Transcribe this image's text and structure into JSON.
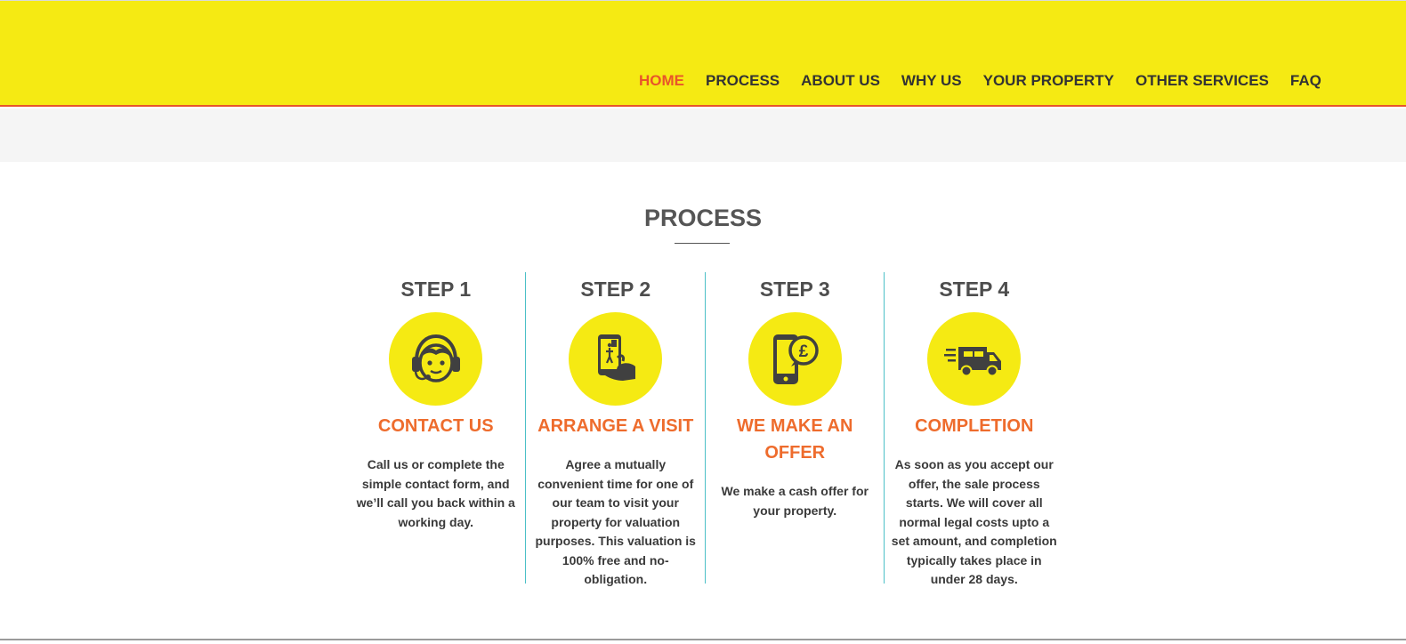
{
  "colors": {
    "header_bg": "#f5ea13",
    "accent": "#e8552a",
    "step_title": "#ee6c2d",
    "divider": "#4cc0c7",
    "icon": "#404040"
  },
  "nav": {
    "items": [
      {
        "label": "HOME",
        "active": true
      },
      {
        "label": "PROCESS",
        "active": false
      },
      {
        "label": "ABOUT US",
        "active": false
      },
      {
        "label": "WHY US",
        "active": false
      },
      {
        "label": "YOUR PROPERTY",
        "active": false
      },
      {
        "label": "OTHER SERVICES",
        "active": false
      },
      {
        "label": "FAQ",
        "active": false
      }
    ]
  },
  "section": {
    "title": "PROCESS"
  },
  "steps": [
    {
      "label": "STEP 1",
      "icon": "headset-person-icon",
      "title": "CONTACT US",
      "description": "Call us or complete the simple contact form, and we’ll call you back within a working day."
    },
    {
      "label": "STEP 2",
      "icon": "phone-in-hand-icon",
      "title": "ARRANGE A VISIT",
      "description": "Agree a mutually convenient time for one of our team to visit your property for valuation purposes. This valuation is 100% free and no-obligation."
    },
    {
      "label": "STEP 3",
      "icon": "phone-pound-offer-icon",
      "title": "WE MAKE AN OFFER",
      "description": "We make a cash offer for your property."
    },
    {
      "label": "STEP 4",
      "icon": "delivery-van-icon",
      "title": "COMPLETION",
      "description": "As soon as you accept our offer, the sale process starts. We will cover all normal legal costs upto a set amount, and completion typically takes place in under 28 days."
    }
  ]
}
